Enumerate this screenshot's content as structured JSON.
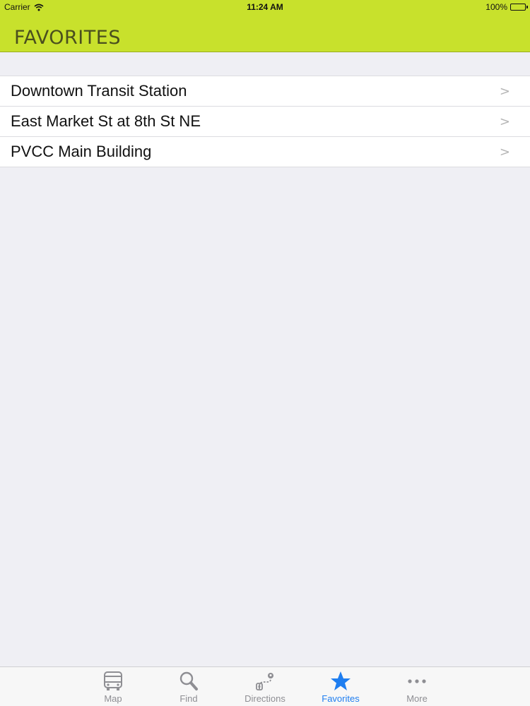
{
  "status_bar": {
    "carrier": "Carrier",
    "time": "11:24 AM",
    "battery_percent": "100%",
    "battery_level": 1.0
  },
  "nav": {
    "title": "FAVORITES"
  },
  "favorites": [
    {
      "label": "Downtown Transit Station",
      "chevron": ">"
    },
    {
      "label": "East Market St at 8th St NE",
      "chevron": ">"
    },
    {
      "label": "PVCC Main Building",
      "chevron": ">"
    }
  ],
  "tab_bar": {
    "active": "favorites",
    "tabs": [
      {
        "label": "Map",
        "icon": "bus-icon"
      },
      {
        "label": "Find",
        "icon": "search-icon"
      },
      {
        "label": "Directions",
        "icon": "route-icon"
      },
      {
        "label": "Favorites",
        "icon": "star-icon"
      },
      {
        "label": "More",
        "icon": "more-dots-icon"
      }
    ]
  },
  "colors": {
    "nav_bar": "#c8e12c",
    "title_text": "#4a4f1e",
    "active_tab": "#1f7ef0",
    "inactive_tab": "#8e8e93",
    "background": "#efeff4"
  }
}
